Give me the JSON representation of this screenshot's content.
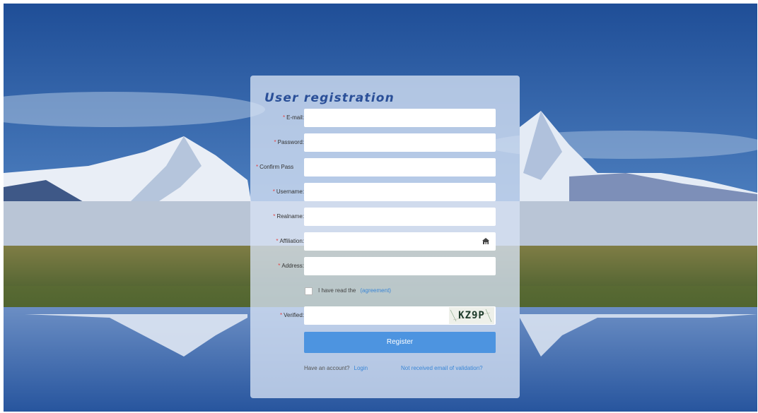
{
  "form": {
    "title": "User registration",
    "fields": [
      {
        "label": "E-mail:",
        "required": true,
        "value": "",
        "placeholder": ""
      },
      {
        "label": "Password:",
        "required": true,
        "value": "",
        "placeholder": ""
      },
      {
        "label": "Confirm Pass",
        "required": true,
        "value": "",
        "placeholder": ""
      },
      {
        "label": "Username:",
        "required": true,
        "value": "",
        "placeholder": ""
      },
      {
        "label": "Realname:",
        "required": true,
        "value": "",
        "placeholder": ""
      },
      {
        "label": "Affiliation:",
        "required": true,
        "value": "",
        "placeholder": "",
        "icon": "institution-icon"
      },
      {
        "label": "Address:",
        "required": true,
        "value": "",
        "placeholder": ""
      }
    ],
    "agreement": {
      "text": "I have read the",
      "link": "(agreement)",
      "checked": false
    },
    "verified": {
      "label": "Verified:",
      "required": true,
      "value": "",
      "captcha": "KZ9P"
    },
    "register_label": "Register",
    "footer": {
      "account_text": "Have an account?",
      "login_link": "Login",
      "resend_link": "Not received email of validation?"
    }
  },
  "colors": {
    "accent": "#4d94e0",
    "link": "#3a86d6",
    "title": "#2a4f98",
    "required": "#e04646"
  }
}
